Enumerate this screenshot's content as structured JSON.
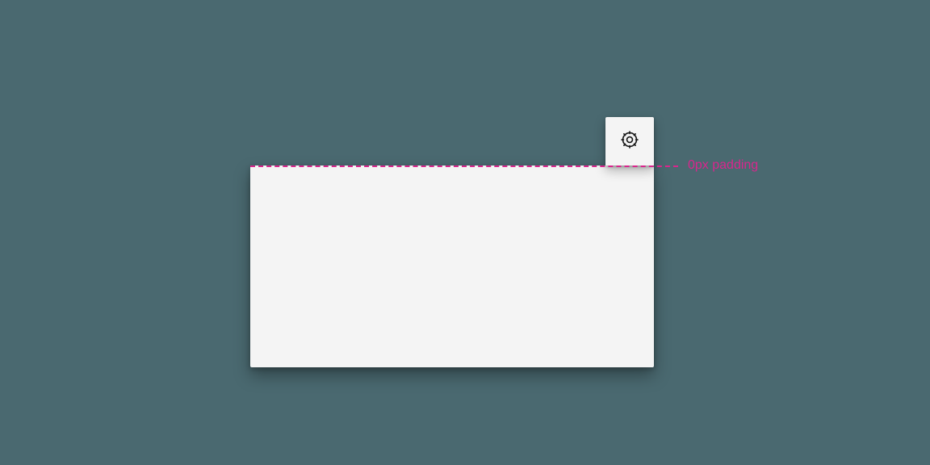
{
  "annotation": {
    "padding_label": "0px padding"
  },
  "icons": {
    "gear": "gear-icon"
  }
}
